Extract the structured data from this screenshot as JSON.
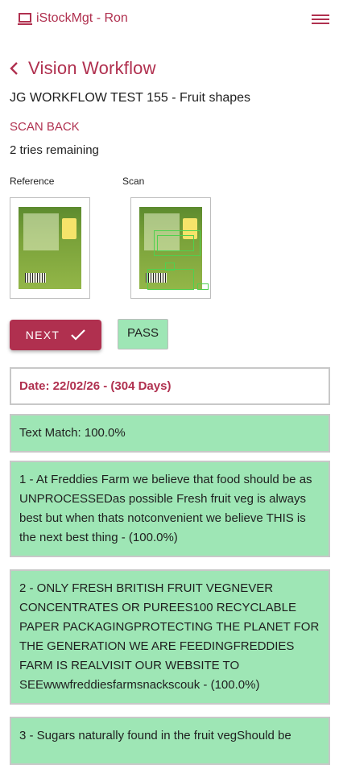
{
  "app": {
    "title": "iStockMgt - Ron"
  },
  "page": {
    "title": "Vision Workflow"
  },
  "workflow": {
    "name": "JG WORKFLOW TEST 155 - Fruit shapes"
  },
  "actions": {
    "scan_back": "SCAN BACK",
    "next": "NEXT",
    "pass": "PASS"
  },
  "tries": "2 tries remaining",
  "images": {
    "reference_label": "Reference",
    "scan_label": "Scan"
  },
  "date_line": "Date: 22/02/26 - (304 Days)",
  "matches": [
    "Text Match: 100.0%",
    "1 - At Freddies Farm we believe that food should be as UNPROCESSEDas possible Fresh fruit veg is always best but when thats notconvenient we believe THIS is the next best thing - (100.0%)",
    "2 - ONLY FRESH BRITISH FRUIT VEGNEVER CONCENTRATES OR PUREES100 RECYCLABLE PAPER PACKAGINGPROTECTING THE PLANET FOR THE GENERATION WE ARE FEEDINGFREDDIES FARM IS REALVISIT OUR WEBSITE TO SEEwwwfreddiesfarmsnackscouk - (100.0%)",
    "3 - Sugars naturally found in the fruit vegShould be"
  ],
  "icons": {
    "app": "laptop-icon",
    "menu": "hamburger-menu-icon",
    "back": "chevron-left-icon",
    "next": "check-icon"
  },
  "colors": {
    "accent": "#b0304f",
    "success_bg": "#9ee6b5"
  }
}
